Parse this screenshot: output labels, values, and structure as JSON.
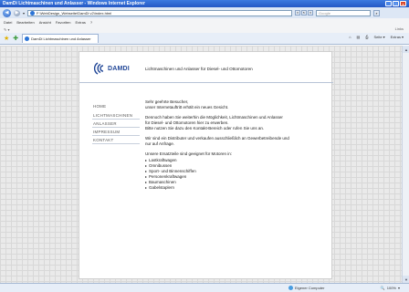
{
  "window": {
    "title": "DamDi Lichtmaschinen und Anlasser - Windows Internet Explorer",
    "min": "_",
    "max": "□",
    "close": "×"
  },
  "addressbar": {
    "url": "F:\\WebDesign_Webseite\\DamDi v2\\index.html",
    "search_placeholder": "Google",
    "search_btn": "⌕"
  },
  "menu": [
    "Datei",
    "Bearbeiten",
    "Ansicht",
    "Favoriten",
    "Extras",
    "?"
  ],
  "links": "Links",
  "tab": {
    "label": "DamDi Lichtmaschinen und Anlasser"
  },
  "commands": {
    "home": "⌂",
    "feeds": "▤",
    "print": "⎙",
    "page": "Seite",
    "tools": "Extras"
  },
  "page": {
    "brand": "DAMDI",
    "tagline": "Lichtmaschinen und Anlasser für Diesel- und Ottomotoren",
    "nav": [
      "HOME",
      "LICHTMASCHINEN",
      "ANLASSER",
      "IMPRESSUM",
      "KONTAKT"
    ],
    "greeting": "Sehr geehrte Besucher,",
    "greeting2": "unser Internetauftritt erhält ein neues Gesicht.",
    "p2a": "Dennoch haben Sie weiterhin die Möglichkeit, Lichtmaschinen und Anlasser",
    "p2b": "für Diesel- und Ottomotoren hier zu erwerben.",
    "p2c": "Bitte nutzen Sie dazu den Kontakt-Bereich oder rufen Sie uns an.",
    "p3a": "Wir sind ein Distributer und verkaufen ausschließlich an Gewerbetreibende und",
    "p3b": "nur auf Anfrage.",
    "p4": "Unsere Ersatzteile sind geeignet für Motoren in:",
    "list": [
      "Lastkraftwagen",
      "Omnibussen",
      "Sport- und Binnenschiffen",
      "Personenkraftwagen",
      "Baumaschinen",
      "Gabelstaplern"
    ]
  },
  "status": {
    "zone": "Eigener Computer",
    "zoom": "100%"
  }
}
